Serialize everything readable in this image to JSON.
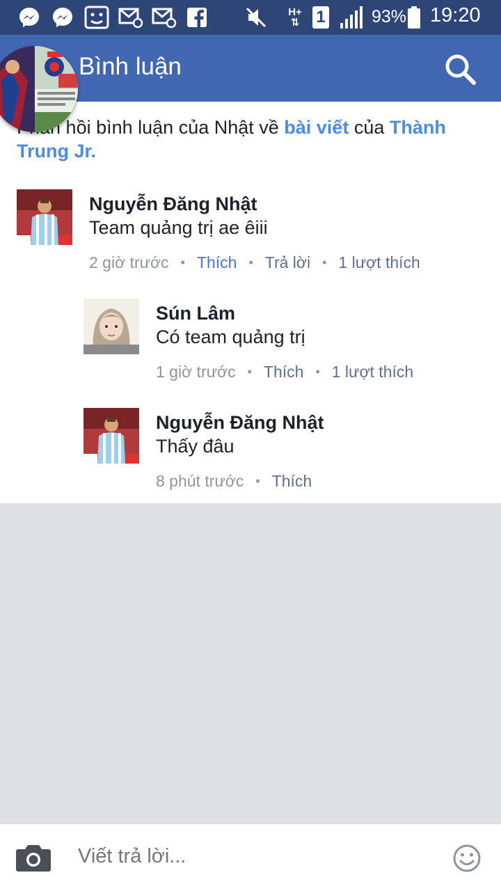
{
  "status_bar": {
    "battery": "93%",
    "time": "19:20",
    "sim": "1",
    "network": "H+",
    "icons": [
      "messenger-icon",
      "messenger-icon",
      "face-icon",
      "email-icon",
      "email-icon",
      "facebook-icon",
      "mute-icon",
      "network-icon",
      "sim-icon",
      "signal-icon",
      "battery-icon"
    ]
  },
  "app_bar": {
    "title": "Bình luận",
    "search_icon": "search-icon"
  },
  "context": {
    "prefix": "Phản hồi bình luận của Nhật về ",
    "post_link": "bài viết",
    "middle": " của ",
    "author_link": "Thành Trung Jr."
  },
  "comments": [
    {
      "name": "Nguyễn Đăng Nhật",
      "text": "Team quảng trị ae êiii",
      "time": "2 giờ trước",
      "like": "Thích",
      "reply": "Trả lời",
      "likes_count": "1 lượt thích"
    },
    {
      "name": "Sún  Lâm",
      "text": "Có team quảng trị",
      "time": "1 giờ trước",
      "like": "Thích",
      "likes_count": "1 lượt thích"
    },
    {
      "name": "Nguyễn Đăng Nhật",
      "text": "Thấy đâu",
      "time": "8 phút trước",
      "like": "Thích"
    }
  ],
  "composer": {
    "placeholder": "Viết trả lời..."
  },
  "colors": {
    "status_bar": "#2e4577",
    "app_bar": "#4267b2",
    "link": "#4a8ce8",
    "background": "#dddfe3"
  }
}
